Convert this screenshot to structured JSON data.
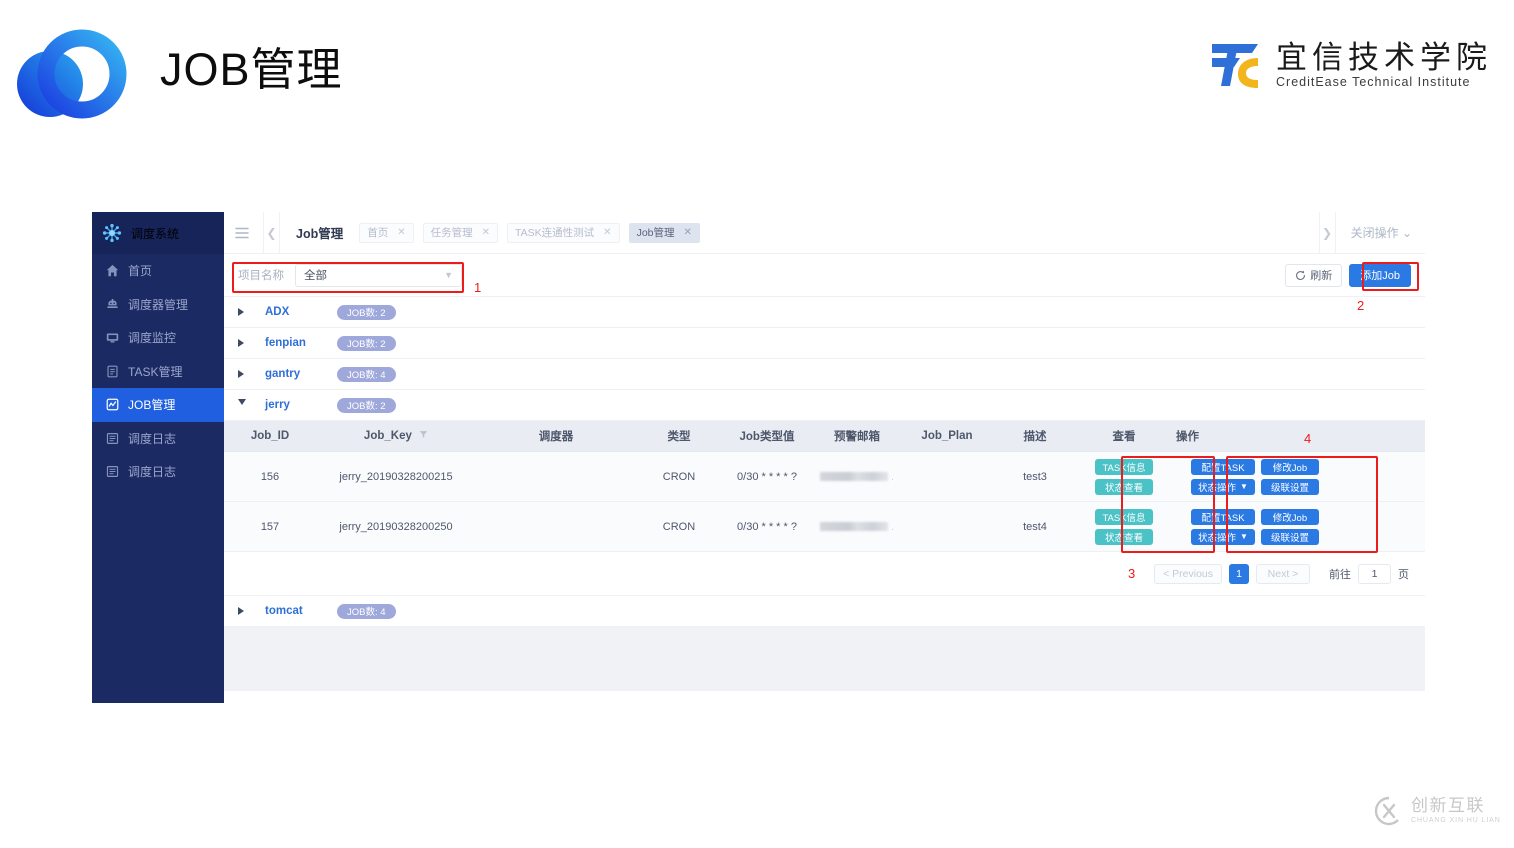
{
  "page_header": {
    "title": "JOB管理",
    "brand_logo_name": "overlapping-circles-logo",
    "org_logo": {
      "mark_name": "tc-monogram-logo",
      "cn": "宜信技术学院",
      "en": "CreditEase Technical Institute",
      "blue": "#2f6fd8",
      "yellow": "#f2b61c"
    }
  },
  "sidebar": {
    "brand": "调度系统",
    "brand_icon": "snowflake-icon",
    "items": [
      {
        "label": "首页",
        "icon": "home-icon",
        "active": false
      },
      {
        "label": "调度器管理",
        "icon": "robot-icon",
        "active": false
      },
      {
        "label": "调度监控",
        "icon": "monitor-icon",
        "active": false
      },
      {
        "label": "TASK管理",
        "icon": "document-icon",
        "active": false
      },
      {
        "label": "JOB管理",
        "icon": "dashboard-icon",
        "active": true
      },
      {
        "label": "调度日志",
        "icon": "log-list-icon",
        "active": false
      },
      {
        "label": "调度日志",
        "icon": "log-list-icon",
        "active": false
      }
    ]
  },
  "topbar": {
    "menu_icon": "hamburger-icon",
    "scroll_left_icon": "chevron-left-icon",
    "scroll_right_icon": "chevron-right-icon",
    "breadcrumb": "Job管理",
    "tabs": [
      {
        "label": "首页",
        "active": false
      },
      {
        "label": "任务管理",
        "active": false
      },
      {
        "label": "TASK连通性测试",
        "active": false
      },
      {
        "label": "Job管理",
        "active": true
      }
    ],
    "tab_close_icon": "close-icon",
    "close_ops_label": "关闭操作",
    "close_ops_caret": "chevron-down-icon"
  },
  "filterbar": {
    "project_label": "项目名称",
    "project_value": "全部",
    "project_placeholder": "全部",
    "project_caret_icon": "chevron-down-icon",
    "refresh_label": "刷新",
    "refresh_icon": "refresh-icon",
    "add_job_label": "添加Job",
    "add_job_color": "#2b7ae4"
  },
  "groups": [
    {
      "name": "ADX",
      "badge": "JOB数: 2",
      "expanded": false
    },
    {
      "name": "fenpian",
      "badge": "JOB数: 2",
      "expanded": false
    },
    {
      "name": "gantry",
      "badge": "JOB数: 4",
      "expanded": false
    },
    {
      "name": "jerry",
      "badge": "JOB数: 2",
      "expanded": true
    },
    {
      "name": "tomcat",
      "badge": "JOB数: 4",
      "expanded": false
    }
  ],
  "table": {
    "columns": [
      {
        "key": "job_id",
        "label": "Job_ID"
      },
      {
        "key": "job_key",
        "label": "Job_Key",
        "filter_icon": "funnel-icon"
      },
      {
        "key": "sched",
        "label": "调度器"
      },
      {
        "key": "type",
        "label": "类型"
      },
      {
        "key": "type_val",
        "label": "Job类型值"
      },
      {
        "key": "mail",
        "label": "预警邮箱"
      },
      {
        "key": "plan",
        "label": "Job_Plan"
      },
      {
        "key": "desc",
        "label": "描述"
      },
      {
        "key": "view",
        "label": "查看"
      },
      {
        "key": "actions",
        "label": "操作"
      }
    ],
    "rows": [
      {
        "job_id": "156",
        "job_key": "jerry_20190328200215",
        "sched": "",
        "type": "CRON",
        "type_val": "0/30 * * * * ?",
        "mail": "",
        "plan": "",
        "desc": "test3"
      },
      {
        "job_id": "157",
        "job_key": "jerry_20190328200250",
        "sched": "",
        "type": "CRON",
        "type_val": "0/30 * * * * ?",
        "mail": "",
        "plan": "",
        "desc": "test4"
      }
    ],
    "view_buttons": [
      {
        "label": "TASK信息",
        "color": "#4bc2c6"
      },
      {
        "label": "状态查看",
        "color": "#4bc2c6"
      }
    ],
    "action_buttons": [
      {
        "label": "配置TASK",
        "color": "#2b7ae4",
        "caret": false
      },
      {
        "label": "修改Job",
        "color": "#2b7ae4",
        "caret": false
      },
      {
        "label": "状态操作",
        "color": "#2b7ae4",
        "caret": true
      },
      {
        "label": "级联设置",
        "color": "#2b7ae4",
        "caret": false
      }
    ]
  },
  "pager": {
    "previous": "< Previous",
    "current_page": "1",
    "next": "Next >",
    "goto_label": "前往",
    "goto_value": "1",
    "goto_unit": "页"
  },
  "annotations": [
    {
      "num": "1"
    },
    {
      "num": "2"
    },
    {
      "num": "3"
    },
    {
      "num": "4"
    }
  ],
  "watermark": {
    "mark_name": "cx-circle-logo",
    "cn": "创新互联",
    "en": "CHUANG XIN HU LIAN"
  }
}
